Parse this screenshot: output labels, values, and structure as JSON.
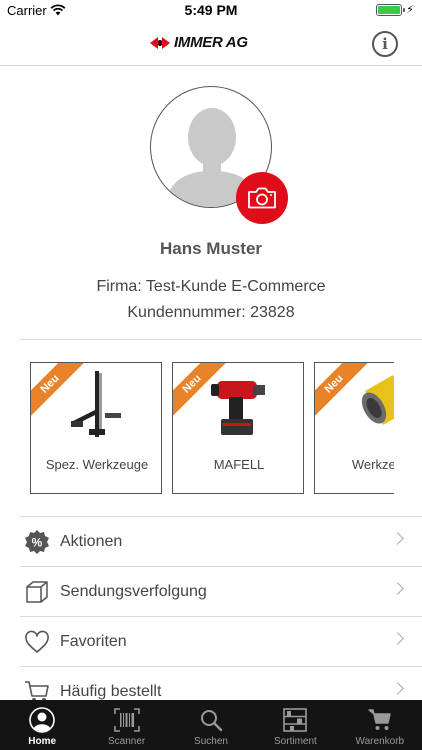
{
  "status_bar": {
    "carrier": "Carrier",
    "time": "5:49 PM",
    "battery_level": 1.0
  },
  "header": {
    "logo_text": "IMMER AG",
    "info_icon": "info-icon",
    "info_glyph": "i"
  },
  "profile": {
    "name": "Hans Muster",
    "company": "Firma: Test-Kunde E-Commerce",
    "customer_number": "Kundennummer: 23828",
    "avatar_icon": "person-placeholder-icon",
    "camera_icon": "camera-icon"
  },
  "categories": [
    {
      "badge": "Neu",
      "label": "Spez. Werkzeuge",
      "image": "clamp-tool"
    },
    {
      "badge": "Neu",
      "label": "MAFELL",
      "image": "impact-driver"
    },
    {
      "badge": "Neu",
      "label": "Werkzeug",
      "image": "core-drill-bit"
    }
  ],
  "menu": [
    {
      "label": "Aktionen",
      "icon": "percent-badge-icon"
    },
    {
      "label": "Sendungsverfolgung",
      "icon": "package-icon"
    },
    {
      "label": "Favoriten",
      "icon": "heart-icon"
    },
    {
      "label": "Häufig bestellt",
      "icon": "cart-icon"
    }
  ],
  "tabs": [
    {
      "label": "Home",
      "icon": "person-icon",
      "active": true
    },
    {
      "label": "Scanner",
      "icon": "barcode-scanner-icon",
      "active": false
    },
    {
      "label": "Suchen",
      "icon": "search-icon",
      "active": false
    },
    {
      "label": "Sortiment",
      "icon": "shelves-icon",
      "active": false
    },
    {
      "label": "Warenkorb",
      "icon": "cart-icon",
      "active": false
    }
  ],
  "colors": {
    "brand_red": "#e10c19",
    "badge_orange": "#e8832a",
    "tab_bar_bg": "#141414",
    "battery_green": "#3dc94b"
  }
}
